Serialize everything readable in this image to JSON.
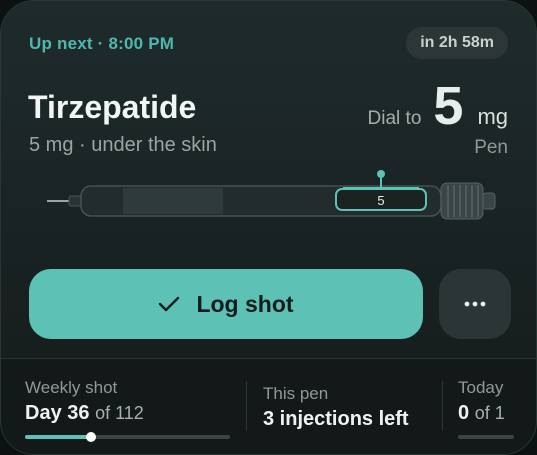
{
  "header": {
    "up_next": "Up next · 8:00 PM",
    "eta_badge": "in 2h 58m"
  },
  "medication": {
    "name": "Tirzepatide",
    "detail": "5 mg · under the skin",
    "dial_label": "Dial to",
    "dial_value": "5",
    "dial_unit": "mg",
    "device": "Pen"
  },
  "pen": {
    "dose_window_label": "5"
  },
  "actions": {
    "log_shot_label": "Log shot",
    "check_icon": "check-icon",
    "more_icon": "more-horizontal-icon"
  },
  "stats": {
    "weekly": {
      "label": "Weekly shot",
      "value": "Day 36",
      "total": "of 112",
      "progress": 0.32
    },
    "pen": {
      "label": "This pen",
      "value": "3 injections left"
    },
    "today": {
      "label": "Today",
      "value": "0",
      "total": "of 1",
      "progress": 0
    }
  },
  "colors": {
    "accent": "#5ec1b6",
    "accent_text": "#4fb8ae",
    "card_bg": "#1f2b2b"
  }
}
